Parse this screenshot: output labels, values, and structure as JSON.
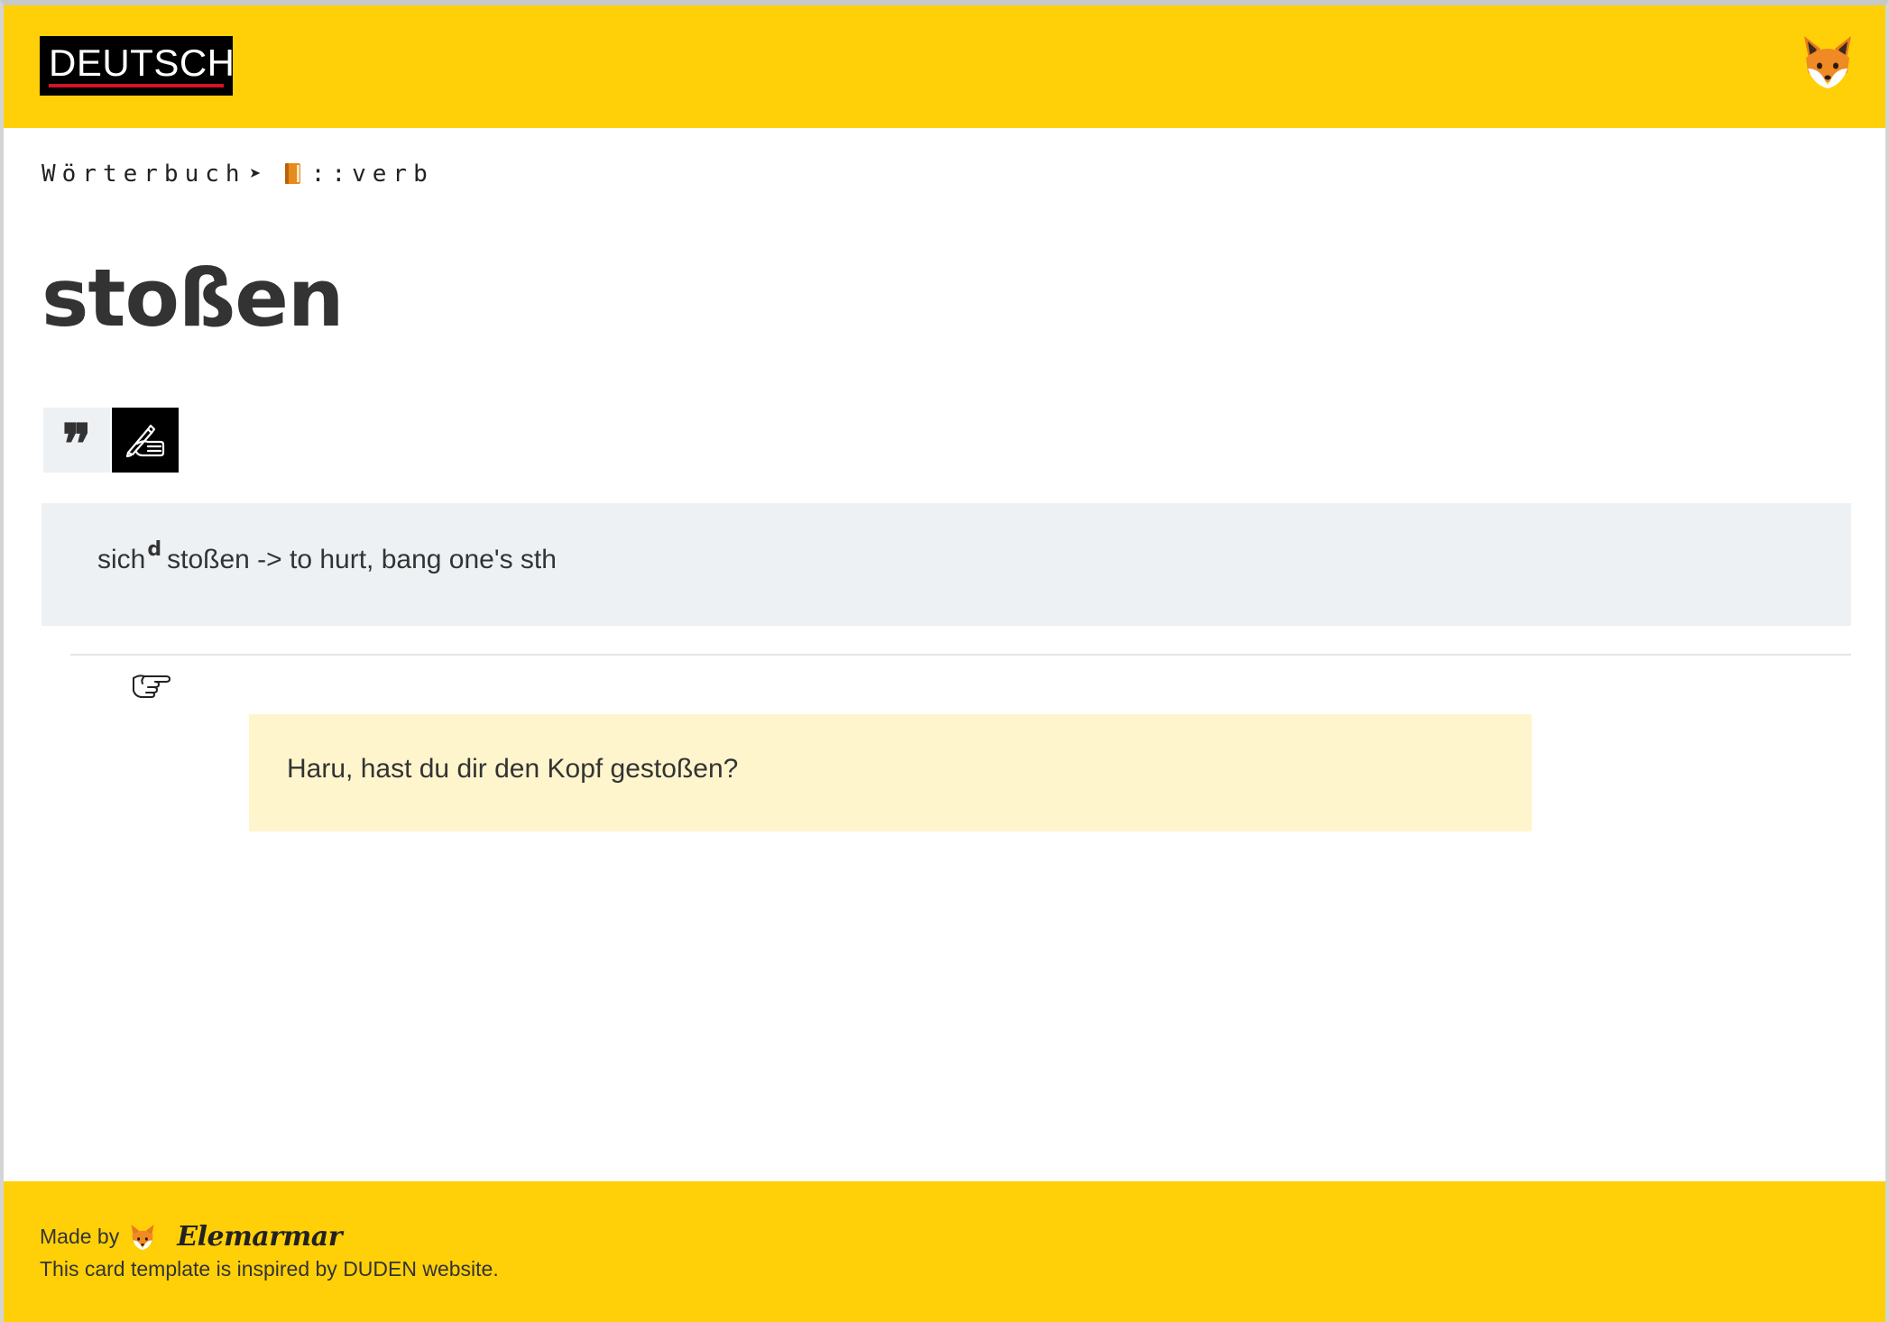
{
  "header": {
    "logo_text": "DEUTSCH",
    "fox_icon": "fox-face-icon"
  },
  "breadcrumb": {
    "root": "Wörterbuch",
    "separator": "➤",
    "book_icon": "orange-book-icon",
    "category": "::verb"
  },
  "entry": {
    "headword": "stoßen",
    "tabs": [
      {
        "name": "quote-tab",
        "icon": "quote-icon",
        "glyph": "❞"
      },
      {
        "name": "write-tab",
        "icon": "writing-hand-icon"
      }
    ],
    "definition": {
      "prefix": "sich",
      "superscript": "d",
      "text": "stoßen -> to hurt, bang one's sth"
    },
    "example_icon": "pointing-hand-icon",
    "example": "Haru, hast du dir den Kopf gestoßen?"
  },
  "footer": {
    "made_by": "Made by",
    "fox_icon": "fox-face-icon",
    "brand": "Elemarmar",
    "credit": "This card template is inspired by DUDEN website."
  },
  "colors": {
    "accent_yellow": "#ffd008",
    "definition_bg": "#edf1f4",
    "example_bg": "#fff5cd",
    "logo_red": "#d31327"
  }
}
